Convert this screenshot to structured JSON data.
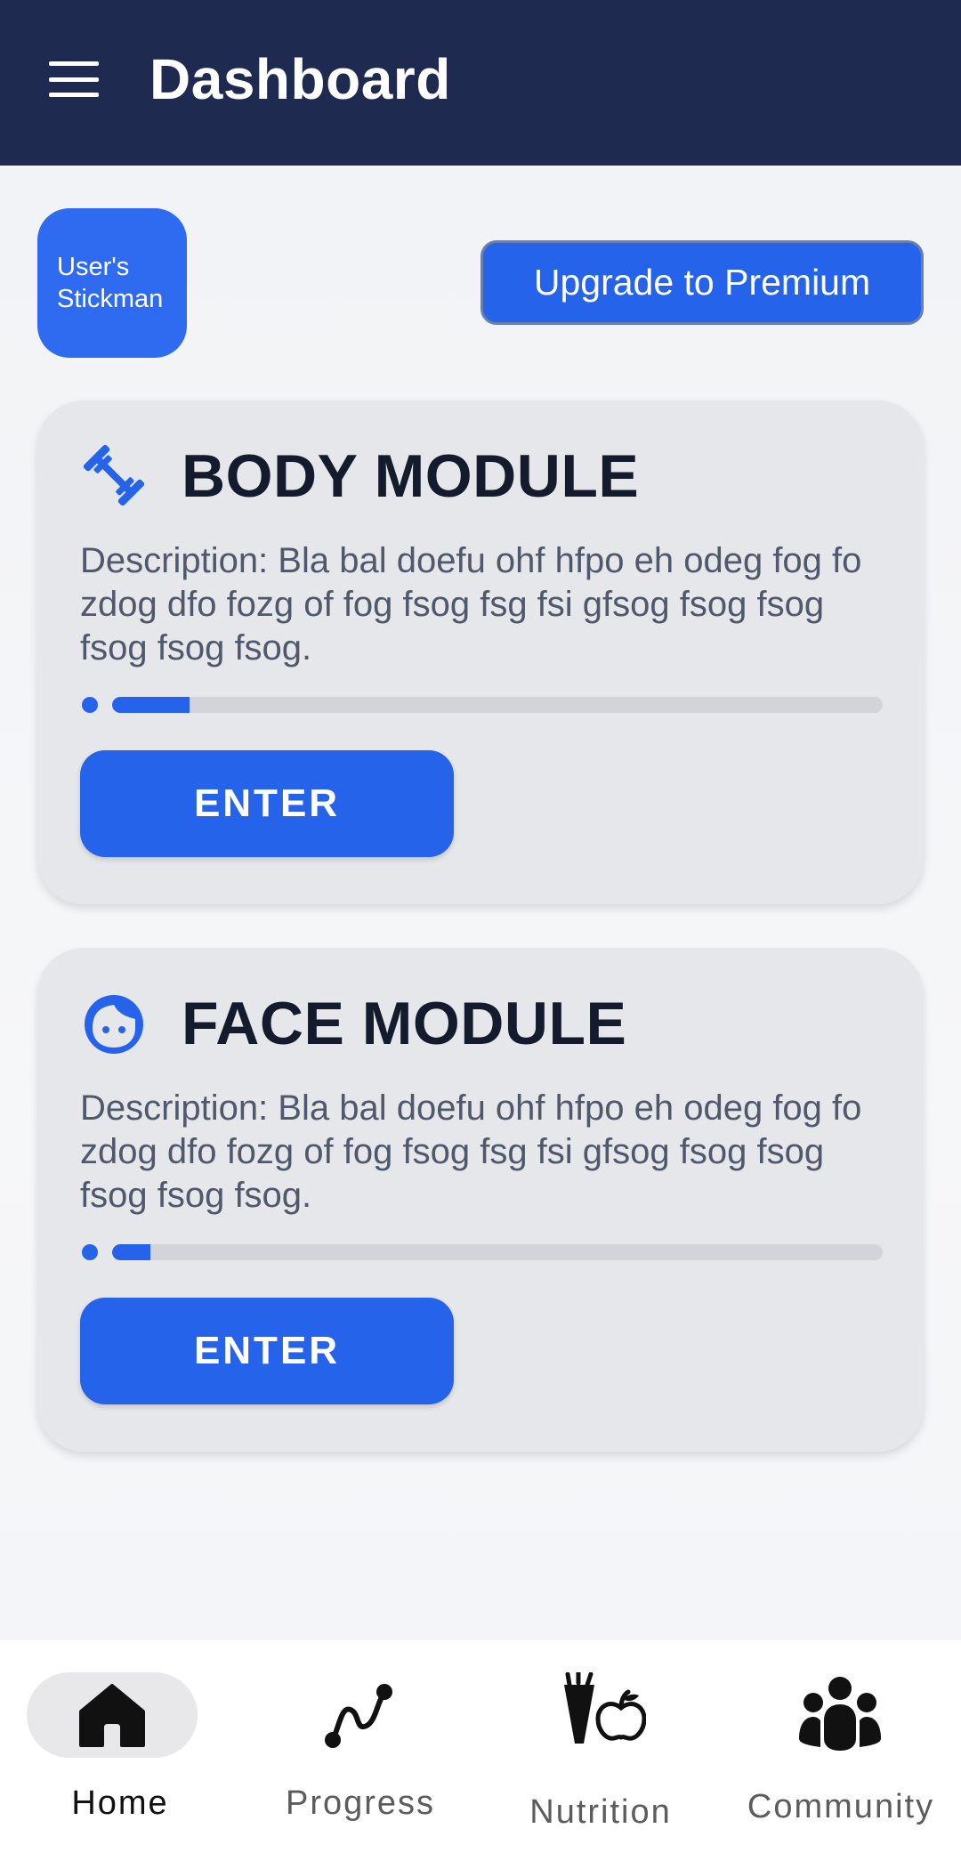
{
  "header": {
    "title": "Dashboard",
    "menu_icon": "hamburger-menu-icon",
    "background_color": "#1e2a4f"
  },
  "user": {
    "stickman_line1": "User's",
    "stickman_line2": "Stickman"
  },
  "premium": {
    "label": "Upgrade to Premium",
    "color": "#2563eb"
  },
  "modules": [
    {
      "icon": "dumbbell-icon",
      "title": "BODY MODULE",
      "description": "Description: Bla bal doefu ohf hfpo eh odeg fog fo zdog dfo fozg of fog fsog fsg fsi gfsog fsog fsog fsog fsog fsog.",
      "progress": 0.1,
      "button_label": "ENTER"
    },
    {
      "icon": "face-icon",
      "title": "FACE MODULE",
      "description": "Description: Bla bal doefu ohf hfpo eh odeg fog fo zdog dfo fozg of fog fsog fsg fsi gfsog fsog fsog fsog fsog fsog.",
      "progress": 0.05,
      "button_label": "ENTER"
    }
  ],
  "bottom_nav": {
    "items": [
      {
        "label": "Home",
        "icon": "home-icon",
        "active": true
      },
      {
        "label": "Progress",
        "icon": "progress-curve-icon",
        "active": false
      },
      {
        "label": "Nutrition",
        "icon": "nutrition-icon",
        "active": false
      },
      {
        "label": "Community",
        "icon": "community-icon",
        "active": false
      }
    ]
  },
  "colors": {
    "accent": "#2563eb",
    "card_background": "#e6e7ea"
  }
}
